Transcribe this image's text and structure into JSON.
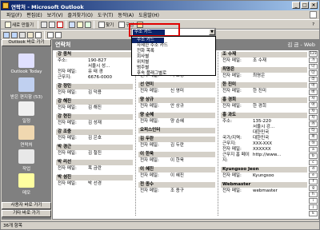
{
  "window": {
    "title": "연락처 - Microsoft Outlook"
  },
  "menu": [
    "파일(F)",
    "편집(E)",
    "보기(V)",
    "즐겨찾기(O)",
    "도구(T)",
    "동작(A)",
    "도움말(H)"
  ],
  "toolbar1": {
    "new_label": "새로 만들기",
    "find_label": "찾기",
    "organize_label": "구성",
    "help_label": "?"
  },
  "toolbar2": {
    "address_value": "주소 카드"
  },
  "view_dropdown": {
    "options": [
      "주소 카드",
      "자세한 주소 카드",
      "전화 목록",
      "회사별",
      "위치별",
      "범주별",
      "후속 플래그별로"
    ]
  },
  "outlook_bar": {
    "header": "Outlook 바로 가기",
    "shortcuts": [
      "Outlook Today",
      "받은 편지함 (53)",
      "일정",
      "연락처",
      "작업",
      "메모"
    ],
    "footer1": "사용자 바로 가기",
    "footer2": "기타 바로 가기"
  },
  "pane": {
    "title": "연락처",
    "range": "김 금 - Web"
  },
  "columns": [
    [
      {
        "name": "강 종처",
        "rows": [
          [
            "주소:",
            "190-827"
          ],
          [
            "",
            "서울시 성..."
          ],
          [
            "전자 메일:",
            "유 태 경"
          ],
          [
            "근무지:",
            "6676-0000"
          ]
        ]
      },
      {
        "name": "강 정민",
        "rows": [
          [
            "전자 메일:",
            "김 덕용"
          ]
        ]
      },
      {
        "name": "강 해진",
        "rows": [
          [
            "전자 메일:",
            "김 해진"
          ]
        ]
      },
      {
        "name": "강 현진",
        "rows": [
          [
            "전자 메일:",
            "김 성재"
          ]
        ]
      },
      {
        "name": "강 조충",
        "rows": [
          [
            "전자 메일:",
            "김 은호"
          ]
        ]
      },
      {
        "name": "박 경근",
        "rows": [
          [
            "전자 메일:",
            "김 철진"
          ]
        ]
      },
      {
        "name": "박 리선",
        "rows": [
          [
            "전자 메일:",
            "목 금란"
          ]
        ]
      },
      {
        "name": "박 섬진",
        "rows": [
          [
            "전자 메일:",
            "박 선경"
          ]
        ]
      }
    ],
    [
      {
        "name": "",
        "rows": [
          [
            "전자 메일:",
            "신 재"
          ]
        ]
      },
      {
        "name": "경 달운",
        "rows": [
          [
            "전자 메일:",
            "서 호정"
          ]
        ]
      },
      {
        "name": "선 연미",
        "rows": [
          [
            "전자 메일:",
            "신 영미"
          ]
        ]
      },
      {
        "name": "양 상규",
        "rows": [
          [
            "전자 메일:",
            "안 상규"
          ]
        ]
      },
      {
        "name": "양 순혜",
        "rows": [
          [
            "전자 메일:",
            "양 순혜"
          ]
        ]
      },
      {
        "name": "오피스인터",
        "rows": []
      },
      {
        "name": "김 두란",
        "rows": [
          [
            "전자 메일:",
            "김 두란"
          ]
        ]
      },
      {
        "name": "이 한욱",
        "rows": [
          [
            "전자 메일:",
            "이 한욱"
          ]
        ]
      },
      {
        "name": "이 혜진",
        "rows": [
          [
            "전자 메일:",
            "이 혜진"
          ]
        ]
      },
      {
        "name": "전 종수",
        "rows": [
          [
            "전자 메일:",
            "조 종구"
          ]
        ]
      }
    ],
    [
      {
        "name": "조 수재",
        "rows": [
          [
            "전자 메일:",
            "조 수재"
          ]
        ]
      },
      {
        "name": "최명은",
        "rows": [
          [
            "전자 메일:",
            "최명은"
          ]
        ]
      },
      {
        "name": "한 진미",
        "rows": [
          [
            "전자 메일:",
            "한 진미"
          ]
        ]
      },
      {
        "name": "홍 경희",
        "rows": [
          [
            "전자 메일:",
            "한 경희"
          ]
        ]
      },
      {
        "name": "홍 과도",
        "rows": [
          [
            "주소:",
            "135-220"
          ],
          [
            "",
            "서울시 강..."
          ],
          [
            "",
            "대한민국"
          ],
          [
            "국가/지역:",
            "대한민국"
          ],
          [
            "근무지:",
            "XXX-XXX"
          ],
          [
            "전자 메일:",
            "XXXXXX"
          ],
          [
            "근무지 홈 페이지:",
            "http://www..."
          ]
        ]
      },
      {
        "name": "Kyungsoo Jeon",
        "rows": [
          [
            "전자 메일:",
            "Kyungsoo"
          ]
        ]
      },
      {
        "name": "Webmaster",
        "rows": [
          [
            "전자 메일:",
            "webmaster"
          ]
        ]
      }
    ]
  ],
  "index_letters": [
    "123",
    "가",
    "나",
    "다",
    "라",
    "마",
    "바",
    "사",
    "아",
    "자",
    "차",
    "카",
    "타",
    "파",
    "하",
    "a",
    "b",
    "c",
    "d",
    "e",
    "f",
    "g",
    "h",
    "i",
    "j",
    "k",
    "l",
    "m",
    "n",
    "o"
  ],
  "status": {
    "text": "36개 항목"
  },
  "colors": {
    "titlebar": "#0a246a",
    "accent_red": "#e00000",
    "outlook_bar": "#808080"
  }
}
